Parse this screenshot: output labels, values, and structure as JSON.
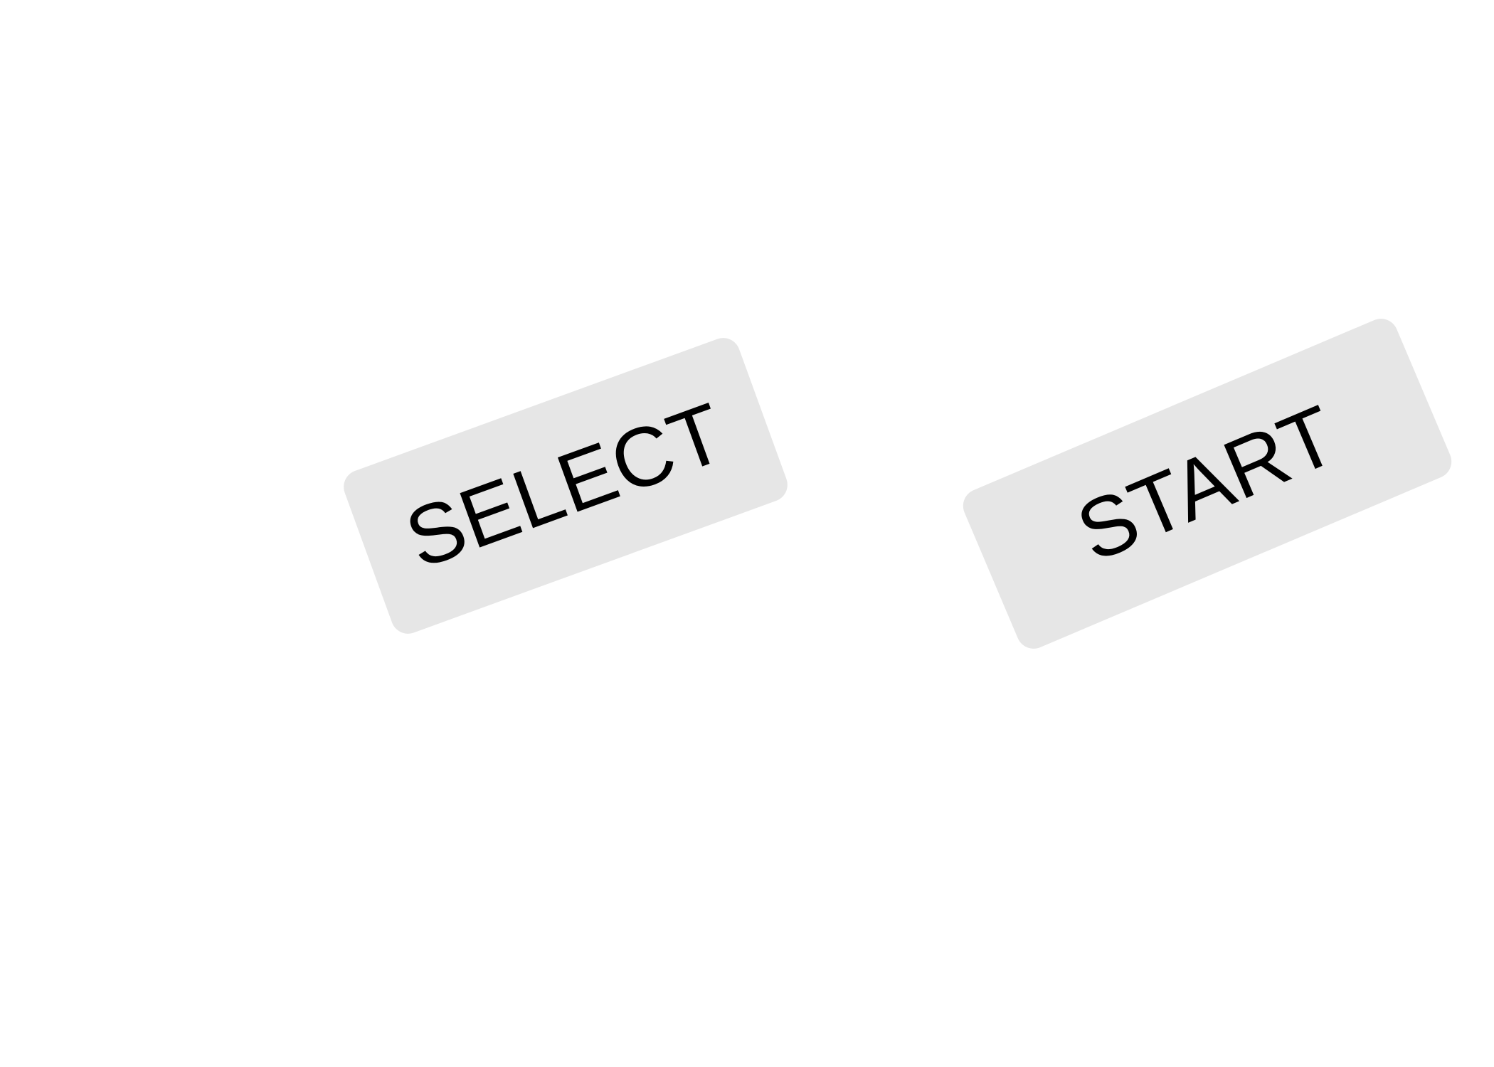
{
  "controls": {
    "select_label": "SELECT",
    "start_label": "START"
  },
  "colors": {
    "background": "#ffffff",
    "button_fill": "#e6e6e6",
    "label_text": "#000000"
  }
}
